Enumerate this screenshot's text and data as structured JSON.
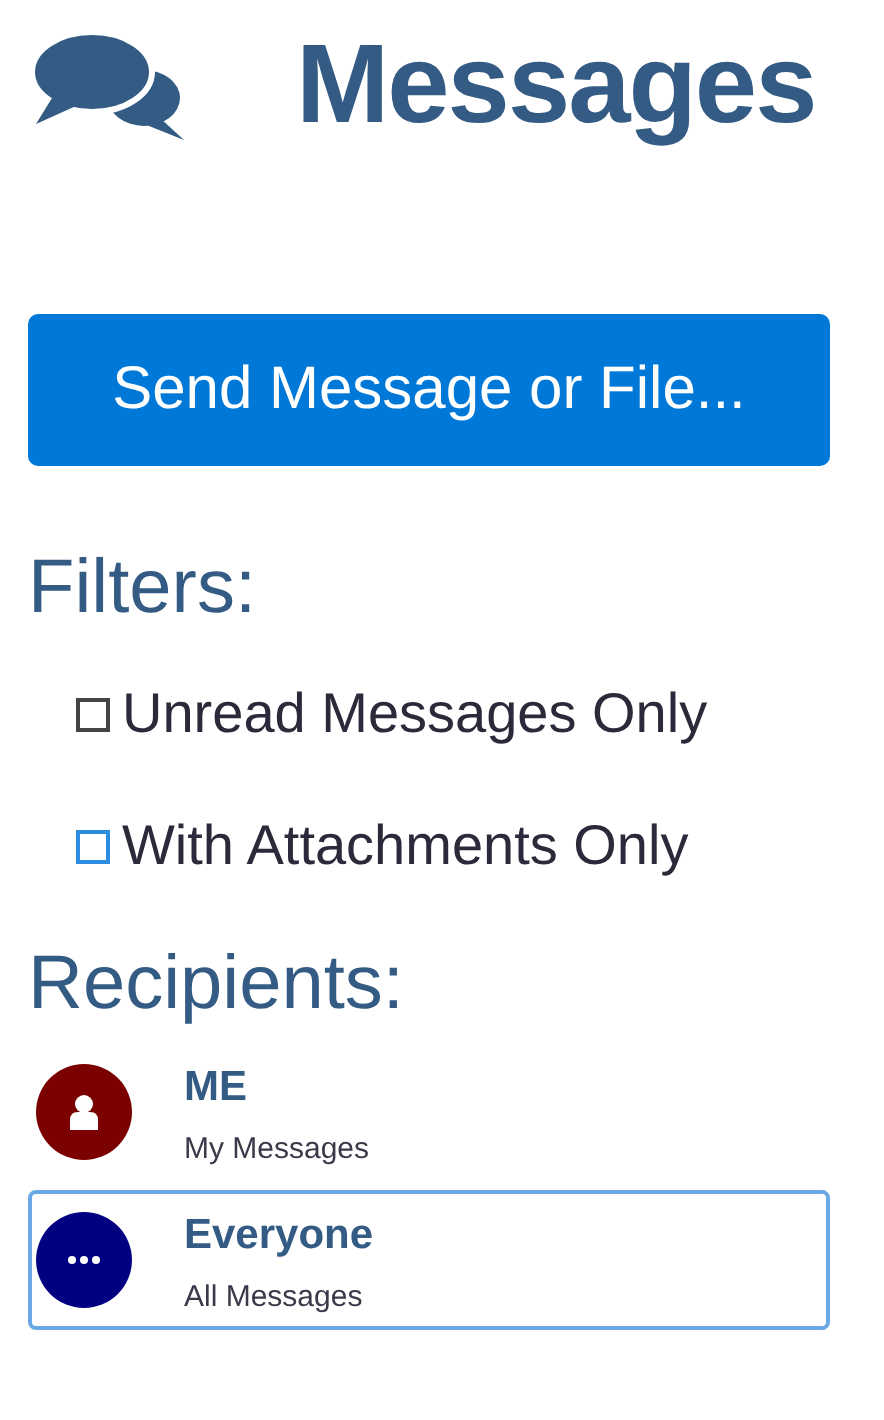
{
  "header": {
    "title": "Messages"
  },
  "send_button": {
    "label": "Send Message or File..."
  },
  "filters": {
    "heading": "Filters:",
    "options": [
      {
        "label": "Unread Messages Only",
        "checked": false,
        "color": "#444444"
      },
      {
        "label": "With Attachments Only",
        "checked": false,
        "color": "#2b8de0"
      }
    ]
  },
  "recipients": {
    "heading": "Recipients:",
    "items": [
      {
        "kind": "person",
        "name": "ME",
        "subtitle": "My Messages",
        "color": "#7b0000",
        "selected": false
      },
      {
        "kind": "group",
        "name": "Everyone",
        "subtitle": "All Messages",
        "color": "#000080",
        "selected": true
      }
    ]
  }
}
